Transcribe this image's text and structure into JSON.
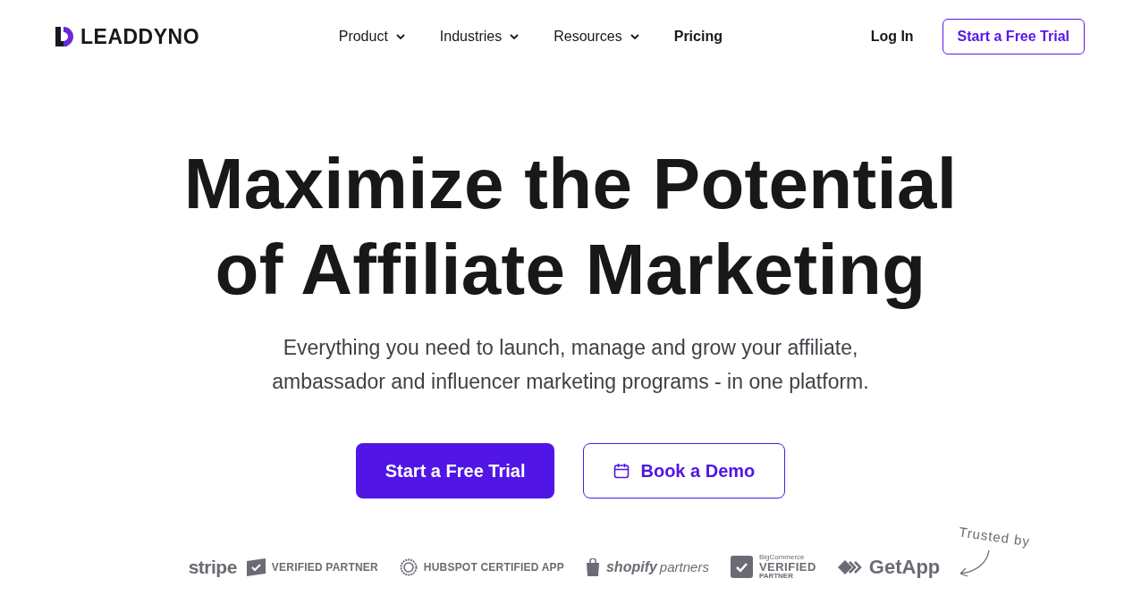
{
  "nav": {
    "logo": "LEADDYNO",
    "menu": [
      {
        "label": "Product",
        "kind": "dropdown"
      },
      {
        "label": "Industries",
        "kind": "dropdown"
      },
      {
        "label": "Resources",
        "kind": "dropdown"
      },
      {
        "label": "Pricing",
        "kind": "link"
      }
    ],
    "login": "Log In",
    "trial_button": "Start a Free Trial"
  },
  "hero": {
    "title_lines": [
      "Maximize the Potential",
      "of Affiliate Marketing"
    ],
    "subtitle_lines": [
      "Everything you need to launch, manage and grow your affiliate,",
      "ambassador and influencer marketing programs - in one platform."
    ],
    "primary_button": "Start a Free Trial",
    "demo_button": "Book a Demo"
  },
  "trust": {
    "caption": "Trusted by",
    "logos": [
      {
        "kind": "stripe",
        "texts": [
          "stripe",
          "VERIFIED PARTNER"
        ]
      },
      {
        "kind": "hubspot",
        "texts": [
          "HUBSPOT CERTIFIED APP"
        ]
      },
      {
        "kind": "shopify",
        "texts": [
          "shopify",
          "partners"
        ]
      },
      {
        "kind": "bigcommerce",
        "texts": [
          "BigCommerce",
          "VERIFIED",
          "PARTNER"
        ]
      },
      {
        "kind": "getapp",
        "texts": [
          "GetApp"
        ]
      }
    ]
  }
}
